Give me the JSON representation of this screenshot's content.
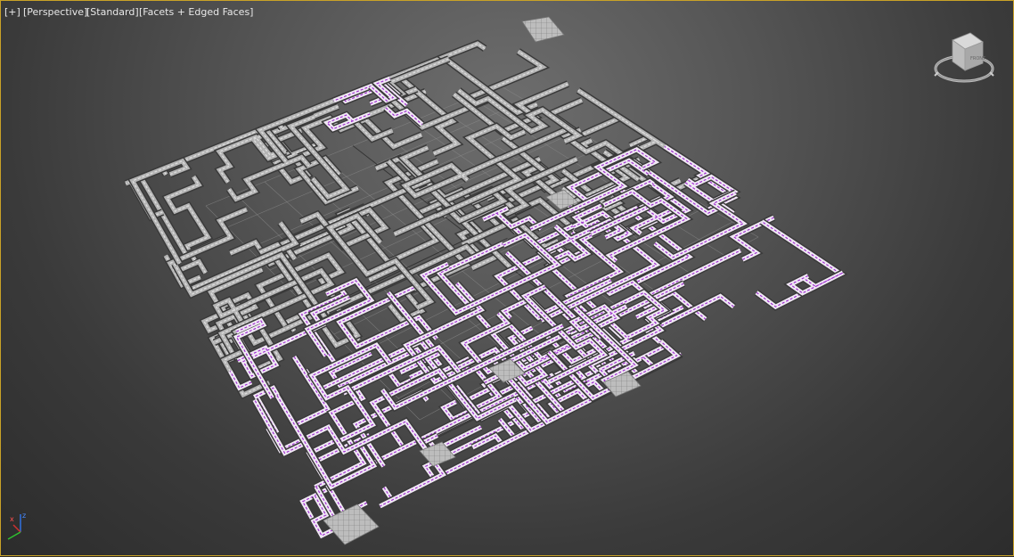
{
  "viewport": {
    "labels": {
      "plus": "[+]",
      "view": "[Perspective]",
      "style": "[Standard]",
      "shading": "[Facets + Edged Faces]"
    },
    "viewcube": {
      "face_label": "FRONT",
      "name": "viewcube"
    },
    "axis": {
      "x": "x",
      "z": "z"
    }
  },
  "colors": {
    "background_center": "#6e6e6e",
    "background_edge": "#2c2c2c",
    "grid": "#8a8a8a",
    "unselected_mesh": "#b0b0b0",
    "selected_mesh": "#a030d0",
    "selected_edge": "#d060ff",
    "viewport_border": "#c9a227",
    "axis_x": "#d03030",
    "axis_z": "#3070e0",
    "axis_y": "#30c030"
  },
  "scene": {
    "description_icons": [
      "dungeon-maze-mesh",
      "perspective-grid"
    ]
  }
}
